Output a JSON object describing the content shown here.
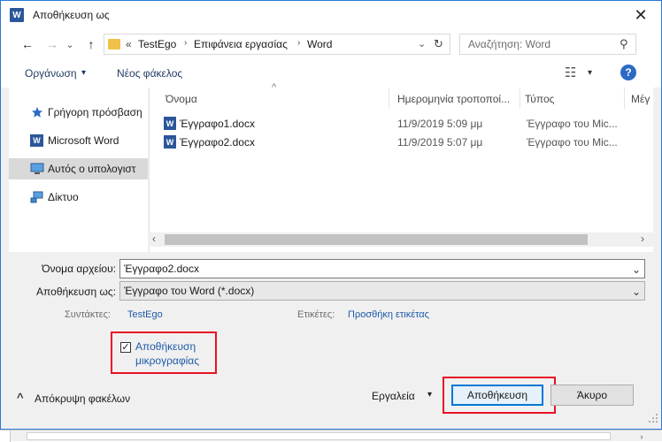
{
  "window": {
    "title": "Αποθήκευση ως",
    "app_badge": "W",
    "close_glyph": "✕"
  },
  "nav": {
    "back_glyph": "←",
    "forward_glyph": "→",
    "dropdown_glyph": "⌄",
    "up_glyph": "↑",
    "prefix": "«",
    "breadcrumbs": [
      "TestEgo",
      "Επιφάνεια εργασίας",
      "Word"
    ],
    "sep_glyph": "›",
    "refresh_glyph": "↻",
    "search_placeholder": "Αναζήτηση: Word",
    "search_glyph": "⚲"
  },
  "toolbar": {
    "organize": "Οργάνωση",
    "organize_caret": "▾",
    "new_folder": "Νέος φάκελος",
    "view_glyph": "☷",
    "view_caret": "▾",
    "help": "?"
  },
  "sidebar": {
    "items": [
      {
        "label": "Γρήγορη πρόσβαση",
        "icon": "star-icon"
      },
      {
        "label": "Microsoft Word",
        "icon": "word-icon"
      },
      {
        "label": "Αυτός ο υπολογιστ",
        "icon": "computer-icon"
      },
      {
        "label": "Δίκτυο",
        "icon": "network-icon"
      }
    ]
  },
  "files": {
    "sort_glyph": "^",
    "columns": [
      "Όνομα",
      "Ημερομηνία τροποποί...",
      "Τύπος",
      "Μέγ"
    ],
    "rows": [
      {
        "name": "Έγγραφο1.docx",
        "date": "11/9/2019 5:09 μμ",
        "type": "Έγγραφο του Mic..."
      },
      {
        "name": "Έγγραφο2.docx",
        "date": "11/9/2019 5:07 μμ",
        "type": "Έγγραφο του Mic..."
      }
    ],
    "scroll_left": "‹",
    "scroll_right": "›"
  },
  "form": {
    "filename_label": "Όνομα αρχείου:",
    "filename_value": "Έγγραφο2.docx",
    "savetype_label": "Αποθήκευση ως:",
    "savetype_value": "Έγγραφο του Word (*.docx)",
    "authors_label": "Συντάκτες:",
    "authors_value": "TestEgo",
    "tags_label": "Ετικέτες:",
    "tags_value": "Προσθήκη ετικέτας",
    "thumb_line1": "Αποθήκευση",
    "thumb_line2": "μικρογραφίας",
    "thumb_checked": "✓"
  },
  "footer": {
    "hide_folders": "Απόκρυψη φακέλων",
    "hide_glyph": "^",
    "tools": "Εργαλεία",
    "tools_caret": "▾",
    "save": "Αποθήκευση",
    "cancel": "Άκυρο"
  },
  "colors": {
    "accent": "#0078d7",
    "highlight_red": "#e81123",
    "word_blue": "#2b579a",
    "link_blue": "#1e5aa8"
  }
}
